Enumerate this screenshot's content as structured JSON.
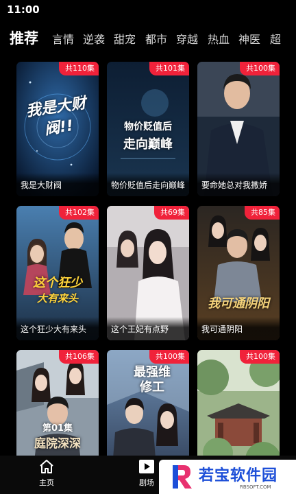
{
  "status_bar": {
    "time": "11:00"
  },
  "category_tabs": [
    {
      "label": "推荐",
      "active": true
    },
    {
      "label": "言情"
    },
    {
      "label": "逆袭"
    },
    {
      "label": "甜宠"
    },
    {
      "label": "都市"
    },
    {
      "label": "穿越"
    },
    {
      "label": "热血"
    },
    {
      "label": "神医"
    },
    {
      "label": "超"
    }
  ],
  "dramas": [
    {
      "title": "我是大财阀",
      "episodes": "共110集",
      "poster_text": "我是大财阀!!"
    },
    {
      "title": "物价贬值后走向巅峰",
      "episodes": "共101集",
      "poster_text": [
        "物价贬值后",
        "走向巅峰"
      ]
    },
    {
      "title": "要命她总对我撒娇",
      "episodes": "共100集"
    },
    {
      "title": "这个狂少大有来头",
      "episodes": "共102集",
      "poster_text": [
        "这个狂少",
        "大有来头"
      ]
    },
    {
      "title": "这个王妃有点野",
      "episodes": "共69集"
    },
    {
      "title": "我可通阴阳",
      "episodes": "共85集",
      "poster_text": "我可通阴阳"
    },
    {
      "title": "庭院深深",
      "episodes": "共106集",
      "poster_text": [
        "第01集",
        "庭院深深"
      ]
    },
    {
      "title": "最强维修工",
      "episodes": "共100集",
      "poster_text": "最强维修工"
    },
    {
      "title": "",
      "episodes": "共100集"
    }
  ],
  "bottom_nav": [
    {
      "label": "主页",
      "icon": "home-icon"
    },
    {
      "label": "剧场",
      "icon": "play-icon"
    }
  ],
  "watermark": {
    "text": "若宝软件园",
    "url": "RBSOFT.COM"
  }
}
